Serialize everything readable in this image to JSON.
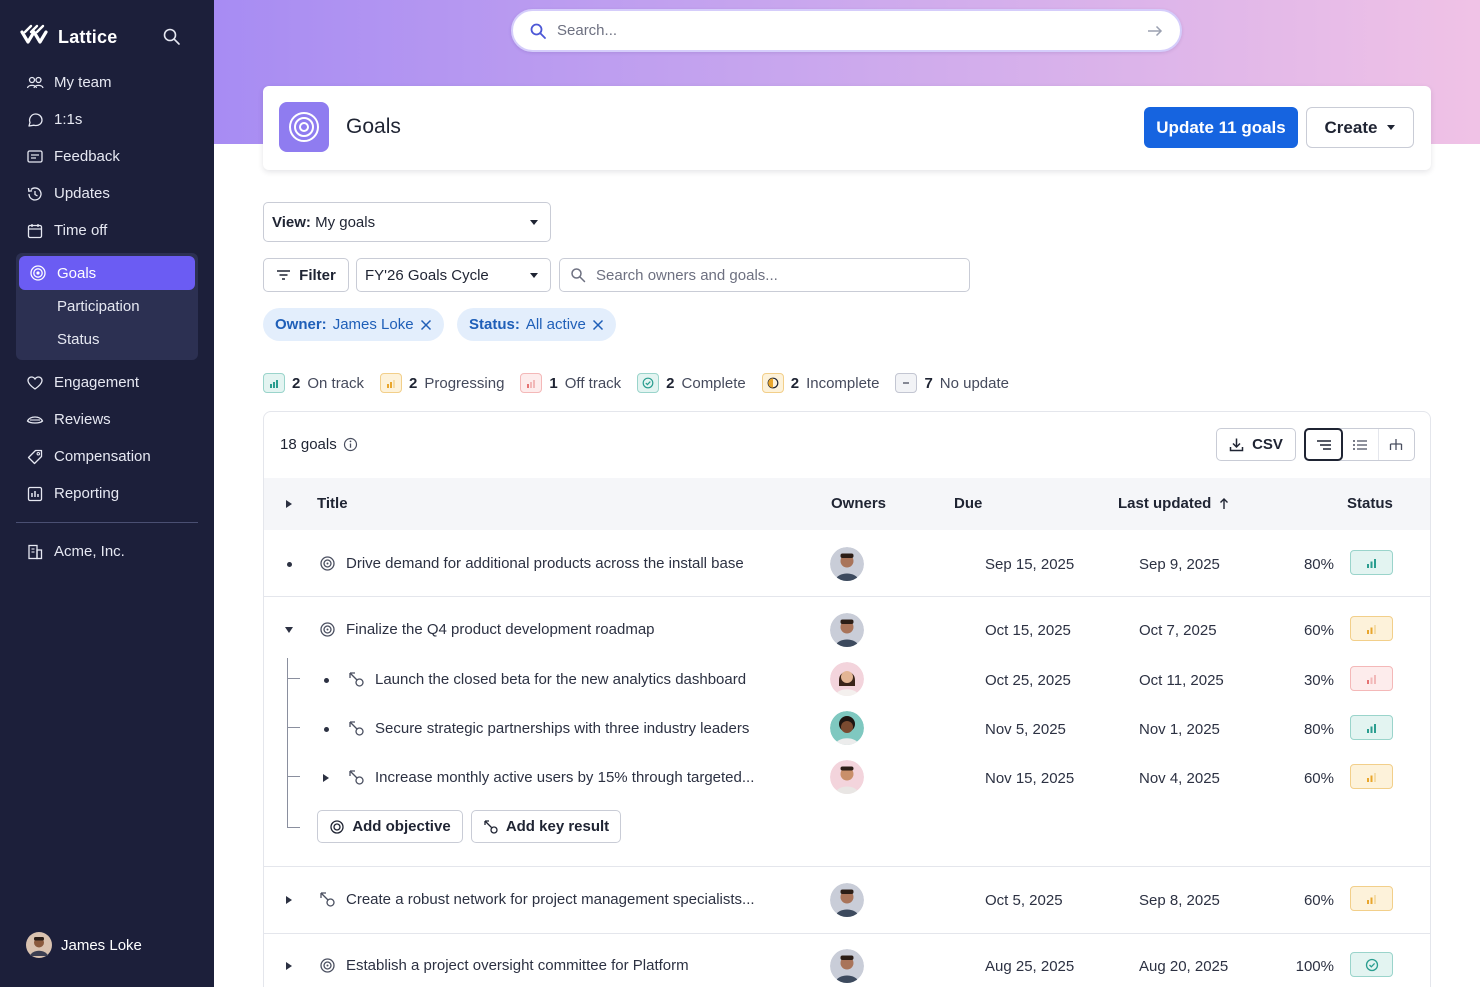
{
  "brand": {
    "name": "Lattice"
  },
  "sidebar": {
    "items": [
      {
        "label": "My team",
        "icon": "team-icon"
      },
      {
        "label": "1:1s",
        "icon": "chat-icon"
      },
      {
        "label": "Feedback",
        "icon": "feedback-icon"
      },
      {
        "label": "Updates",
        "icon": "updates-icon"
      },
      {
        "label": "Time off",
        "icon": "calendar-icon"
      }
    ],
    "goals": {
      "label": "Goals",
      "sub": [
        "Participation",
        "Status"
      ]
    },
    "items2": [
      {
        "label": "Engagement",
        "icon": "heart-icon"
      },
      {
        "label": "Reviews",
        "icon": "reviews-icon"
      },
      {
        "label": "Compensation",
        "icon": "compensation-icon"
      },
      {
        "label": "Reporting",
        "icon": "reporting-icon"
      }
    ],
    "company": "Acme, Inc.",
    "user": "James Loke"
  },
  "search": {
    "placeholder": "Search..."
  },
  "header": {
    "title": "Goals",
    "update_label": "Update 11 goals",
    "create_label": "Create"
  },
  "controls": {
    "view_prefix": "View:",
    "view_value": "My goals",
    "filter_label": "Filter",
    "cycle_value": "FY'26 Goals Cycle",
    "search_placeholder": "Search owners and goals...",
    "chips": [
      {
        "key": "Owner:",
        "value": "James Loke"
      },
      {
        "key": "Status:",
        "value": "All active"
      }
    ]
  },
  "stats": [
    {
      "count": "2",
      "label": "On track",
      "color": "#2a9d8f"
    },
    {
      "count": "2",
      "label": "Progressing",
      "color": "#e9a62c"
    },
    {
      "count": "1",
      "label": "Off track",
      "color": "#e57373"
    },
    {
      "count": "2",
      "label": "Complete",
      "color": "#2a9d8f"
    },
    {
      "count": "2",
      "label": "Incomplete",
      "color": "#e9a62c"
    },
    {
      "count": "7",
      "label": "No update",
      "color": "#7a7f91"
    }
  ],
  "table": {
    "count_label": "18 goals",
    "csv_label": "CSV",
    "columns": {
      "title": "Title",
      "owners": "Owners",
      "due": "Due",
      "last_updated": "Last updated",
      "status": "Status"
    },
    "rows": [
      {
        "title": "Drive demand for additional products across the install base",
        "due": "Sep 15, 2025",
        "updated": "Sep 9, 2025",
        "pct": "80%",
        "status": "on-track"
      },
      {
        "title": "Finalize the Q4 product development roadmap",
        "due": "Oct 15, 2025",
        "updated": "Oct 7, 2025",
        "pct": "60%",
        "status": "progressing"
      },
      {
        "title": "Launch the closed beta for the new analytics dashboard",
        "due": "Oct 25, 2025",
        "updated": "Oct 11, 2025",
        "pct": "30%",
        "status": "off-track"
      },
      {
        "title": "Secure strategic partnerships with three industry leaders",
        "due": "Nov 5, 2025",
        "updated": "Nov 1, 2025",
        "pct": "80%",
        "status": "on-track"
      },
      {
        "title": "Increase monthly active users by 15% through targeted...",
        "due": "Nov 15, 2025",
        "updated": "Nov 4, 2025",
        "pct": "60%",
        "status": "progressing"
      },
      {
        "title": "Create a robust network for project management specialists...",
        "due": "Oct 5, 2025",
        "updated": "Sep 8, 2025",
        "pct": "60%",
        "status": "progressing"
      },
      {
        "title": "Establish a project oversight committee for Platform",
        "due": "Aug 25, 2025",
        "updated": "Aug 20, 2025",
        "pct": "100%",
        "status": "complete"
      }
    ],
    "add_objective_label": "Add objective",
    "add_key_result_label": "Add key result"
  },
  "colors": {
    "sidebar_bg": "#1c1f3a",
    "accent": "#6b5cf3",
    "primary_button": "#1664e0",
    "on_track": "#2a9d8f",
    "progressing": "#e9a62c",
    "off_track": "#e57373"
  }
}
